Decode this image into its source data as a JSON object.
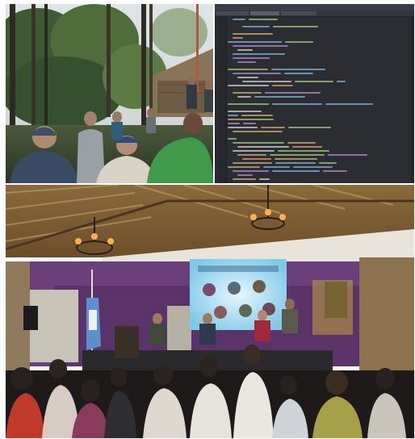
{
  "images": [
    {
      "name": "forest-field-visit-photo"
    },
    {
      "name": "code-editor-screenshot"
    },
    {
      "name": "conference-panel-photo"
    }
  ]
}
